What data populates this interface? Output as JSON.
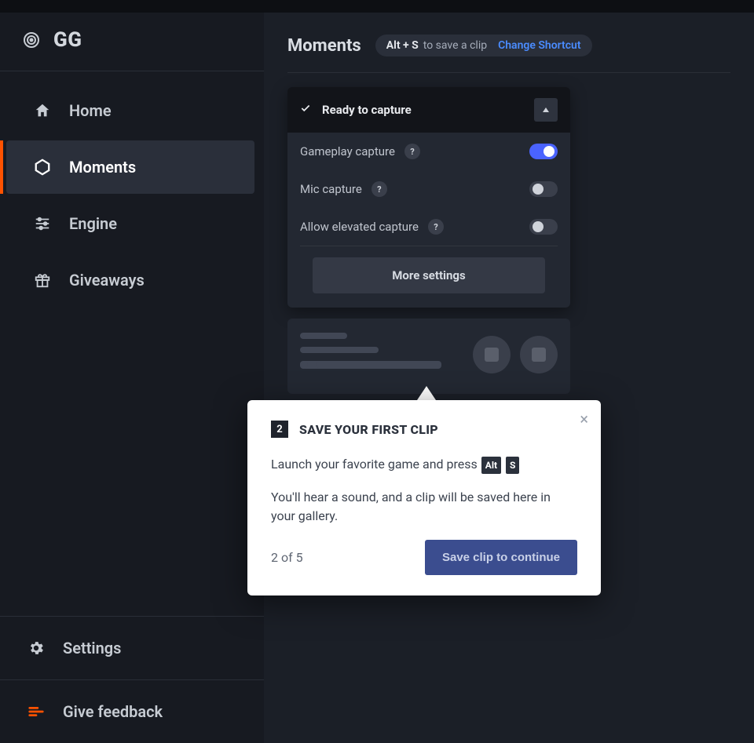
{
  "brand": "GG",
  "sidebar": {
    "items": [
      {
        "label": "Home"
      },
      {
        "label": "Moments"
      },
      {
        "label": "Engine"
      },
      {
        "label": "Giveaways"
      }
    ],
    "bottom": [
      {
        "label": "Settings"
      },
      {
        "label": "Give feedback"
      }
    ]
  },
  "header": {
    "title": "Moments",
    "hint_shortcut": "Alt + S",
    "hint_text": "to save a clip",
    "change_link": "Change Shortcut"
  },
  "capture": {
    "status": "Ready to capture",
    "rows": [
      {
        "label": "Gameplay capture",
        "on": true
      },
      {
        "label": "Mic capture",
        "on": false
      },
      {
        "label": "Allow elevated capture",
        "on": false
      }
    ],
    "more": "More settings"
  },
  "popover": {
    "step_num": "2",
    "title": "SAVE YOUR FIRST CLIP",
    "line1_pre": "Launch your favorite game and press ",
    "key1": "Alt",
    "key2": "S",
    "line2": "You'll hear a sound, and a clip will be saved here in your gallery.",
    "step_text": "2 of 5",
    "cta": "Save clip to continue"
  }
}
